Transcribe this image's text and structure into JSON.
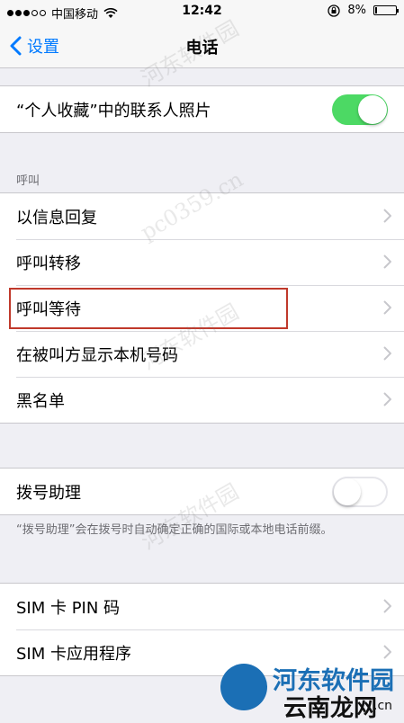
{
  "status_bar": {
    "carrier": "中国移动",
    "time": "12:42",
    "battery": "8%"
  },
  "nav": {
    "back_label": "设置",
    "title": "电话"
  },
  "favorites_row": {
    "label": "“个人收藏”中的联系人照片",
    "toggle_on": true
  },
  "calls_section": {
    "header": "呼叫",
    "items": [
      {
        "label": "以信息回复"
      },
      {
        "label": "呼叫转移"
      },
      {
        "label": "呼叫等待"
      },
      {
        "label": "在被叫方显示本机号码"
      },
      {
        "label": "黑名单"
      }
    ]
  },
  "dial_assist": {
    "label": "拨号助理",
    "toggle_on": false,
    "note": "“拨号助理”会在拨号时自动确定正确的国际或本地电话前缀。"
  },
  "sim_section": {
    "items": [
      {
        "label": "SIM 卡 PIN 码"
      },
      {
        "label": "SIM 卡应用程序"
      }
    ]
  },
  "watermark": {
    "site_name": "河东软件园",
    "domain": "pc0359.cn",
    "brand": "河东软件园",
    "brand_domain": "云南龙网",
    "brand_domain_suffix": ".cn"
  },
  "colors": {
    "accent": "#007aff",
    "toggle_on": "#4cd964",
    "highlight_box": "#c0392b"
  }
}
